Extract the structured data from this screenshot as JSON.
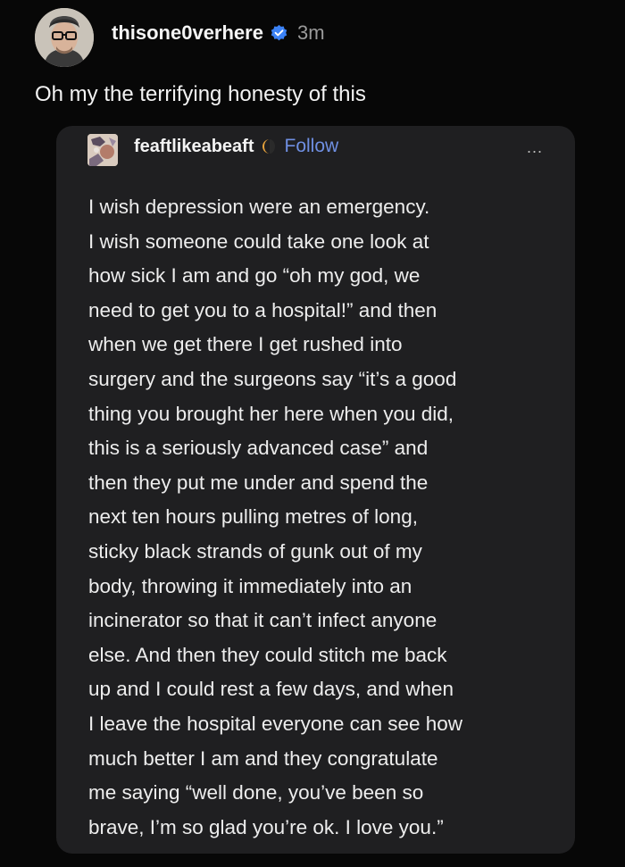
{
  "post": {
    "username": "thisone0verhere",
    "time": "3m",
    "caption": "Oh my the terrifying honesty of this",
    "icons": {
      "avatar": "user-avatar-icon",
      "verified": "verified-badge-icon"
    },
    "verified_color": "#3b82f6"
  },
  "repost": {
    "username": "feaftlikeabeaft",
    "follow_label": "Follow",
    "more_label": "...",
    "follow_color": "#6f8fe2",
    "icons": {
      "avatar": "blog-avatar-icon",
      "badge": "moon-badge-icon",
      "more": "more-options-icon"
    },
    "lines": [
      "I wish depression were an emergency.",
      "I wish someone could take one look at",
      "how sick I am and go “oh my god, we",
      "need to get you to a hospital!” and then",
      "when we get there I get rushed into",
      "surgery and the surgeons say “it’s a good",
      "thing you brought her here when you did,",
      "this is a seriously advanced case” and",
      "then they put me under and spend the",
      "next ten hours pulling metres of long,",
      "sticky black strands of gunk out of my",
      "body, throwing it immediately into an",
      "incinerator so that it can’t infect anyone",
      "else. And then they could stitch me back",
      "up and I could rest a few days, and when",
      "I leave the hospital everyone can see how",
      "much better I am and they congratulate",
      "me saying “well done, you’ve been so",
      "brave, I’m so glad you’re ok. I love you.”"
    ]
  }
}
